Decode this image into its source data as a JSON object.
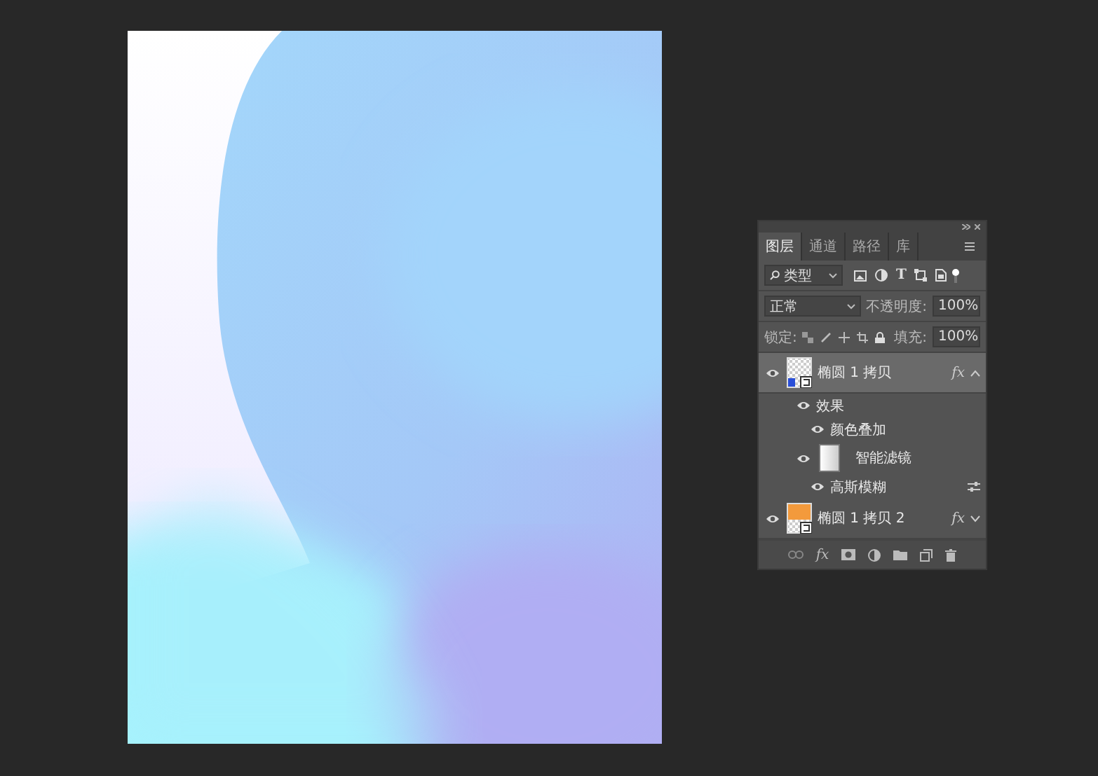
{
  "tabs": [
    {
      "label": "图层",
      "selected": true
    },
    {
      "label": "通道",
      "selected": false
    },
    {
      "label": "路径",
      "selected": false
    },
    {
      "label": "库",
      "selected": false
    }
  ],
  "filter": {
    "value": "类型",
    "icons": [
      {
        "kind": "pixel"
      },
      {
        "kind": "adjustment"
      },
      {
        "kind": "type",
        "label": "T"
      },
      {
        "kind": "shape"
      },
      {
        "kind": "smart"
      }
    ]
  },
  "blend_mode": {
    "value": "正常"
  },
  "opacity": {
    "label": "不透明度:",
    "value": "100%"
  },
  "lock": {
    "label": "锁定:"
  },
  "fill": {
    "label": "填充:",
    "value": "100%"
  },
  "layers": [
    {
      "name": "椭圆 1 拷贝",
      "selected": true,
      "visible": true,
      "expanded": true,
      "color": "#2a4fd8",
      "fx": "fx",
      "children": [
        {
          "name": "效果",
          "visible": true,
          "kind": "effects",
          "children": [
            {
              "name": "颜色叠加",
              "visible": true,
              "kind": "effect"
            }
          ]
        },
        {
          "name": "智能滤镜",
          "visible": true,
          "kind": "smart-filters",
          "children": [
            {
              "name": "高斯模糊",
              "visible": true,
              "kind": "filter"
            }
          ]
        }
      ]
    },
    {
      "name": "椭圆 1 拷贝 2",
      "selected": false,
      "visible": true,
      "expanded": false,
      "color": "#f39a3c",
      "fx": "fx"
    }
  ],
  "toolbar": [
    {
      "kind": "link"
    },
    {
      "kind": "fx",
      "label": "fx"
    },
    {
      "kind": "mask"
    },
    {
      "kind": "adjustment"
    },
    {
      "kind": "folder"
    },
    {
      "kind": "new"
    },
    {
      "kind": "trash"
    }
  ]
}
